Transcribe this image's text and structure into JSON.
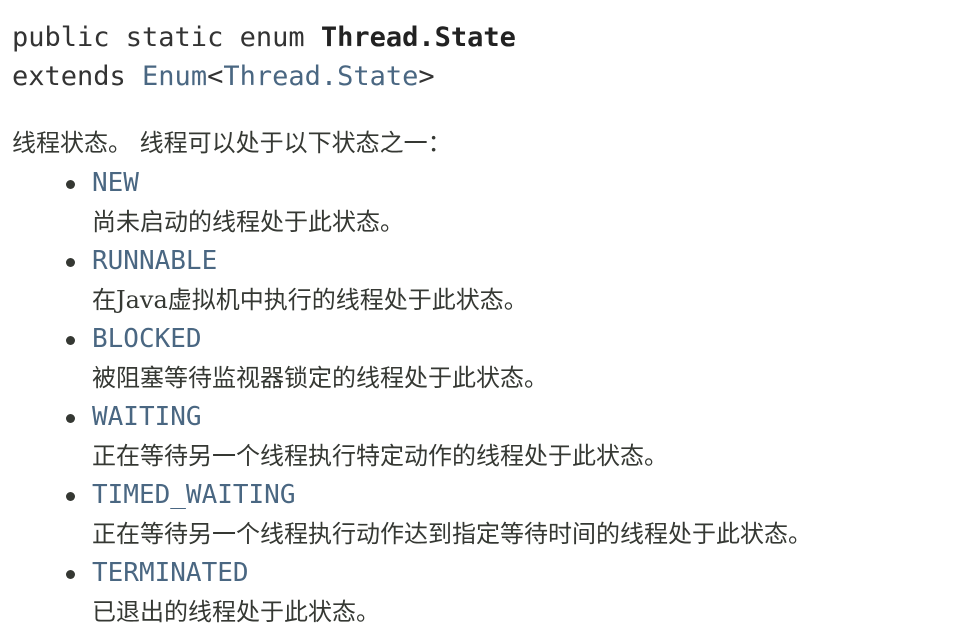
{
  "signature": {
    "line1_prefix": "public static enum ",
    "class_name": "Thread.State",
    "line2_prefix": "extends ",
    "enum_link": "Enum",
    "generic_open": "<",
    "generic_type_link": "Thread.State",
    "generic_close": ">"
  },
  "description": "线程状态。 线程可以处于以下状态之一：",
  "constants": [
    {
      "name": "NEW",
      "desc": "尚未启动的线程处于此状态。"
    },
    {
      "name": "RUNNABLE",
      "desc": "在Java虚拟机中执行的线程处于此状态。"
    },
    {
      "name": "BLOCKED",
      "desc": "被阻塞等待监视器锁定的线程处于此状态。"
    },
    {
      "name": "WAITING",
      "desc": "正在等待另一个线程执行特定动作的线程处于此状态。"
    },
    {
      "name": "TIMED_WAITING",
      "desc": "正在等待另一个线程执行动作达到指定等待时间的线程处于此状态。"
    },
    {
      "name": "TERMINATED",
      "desc": "已退出的线程处于此状态。"
    }
  ]
}
